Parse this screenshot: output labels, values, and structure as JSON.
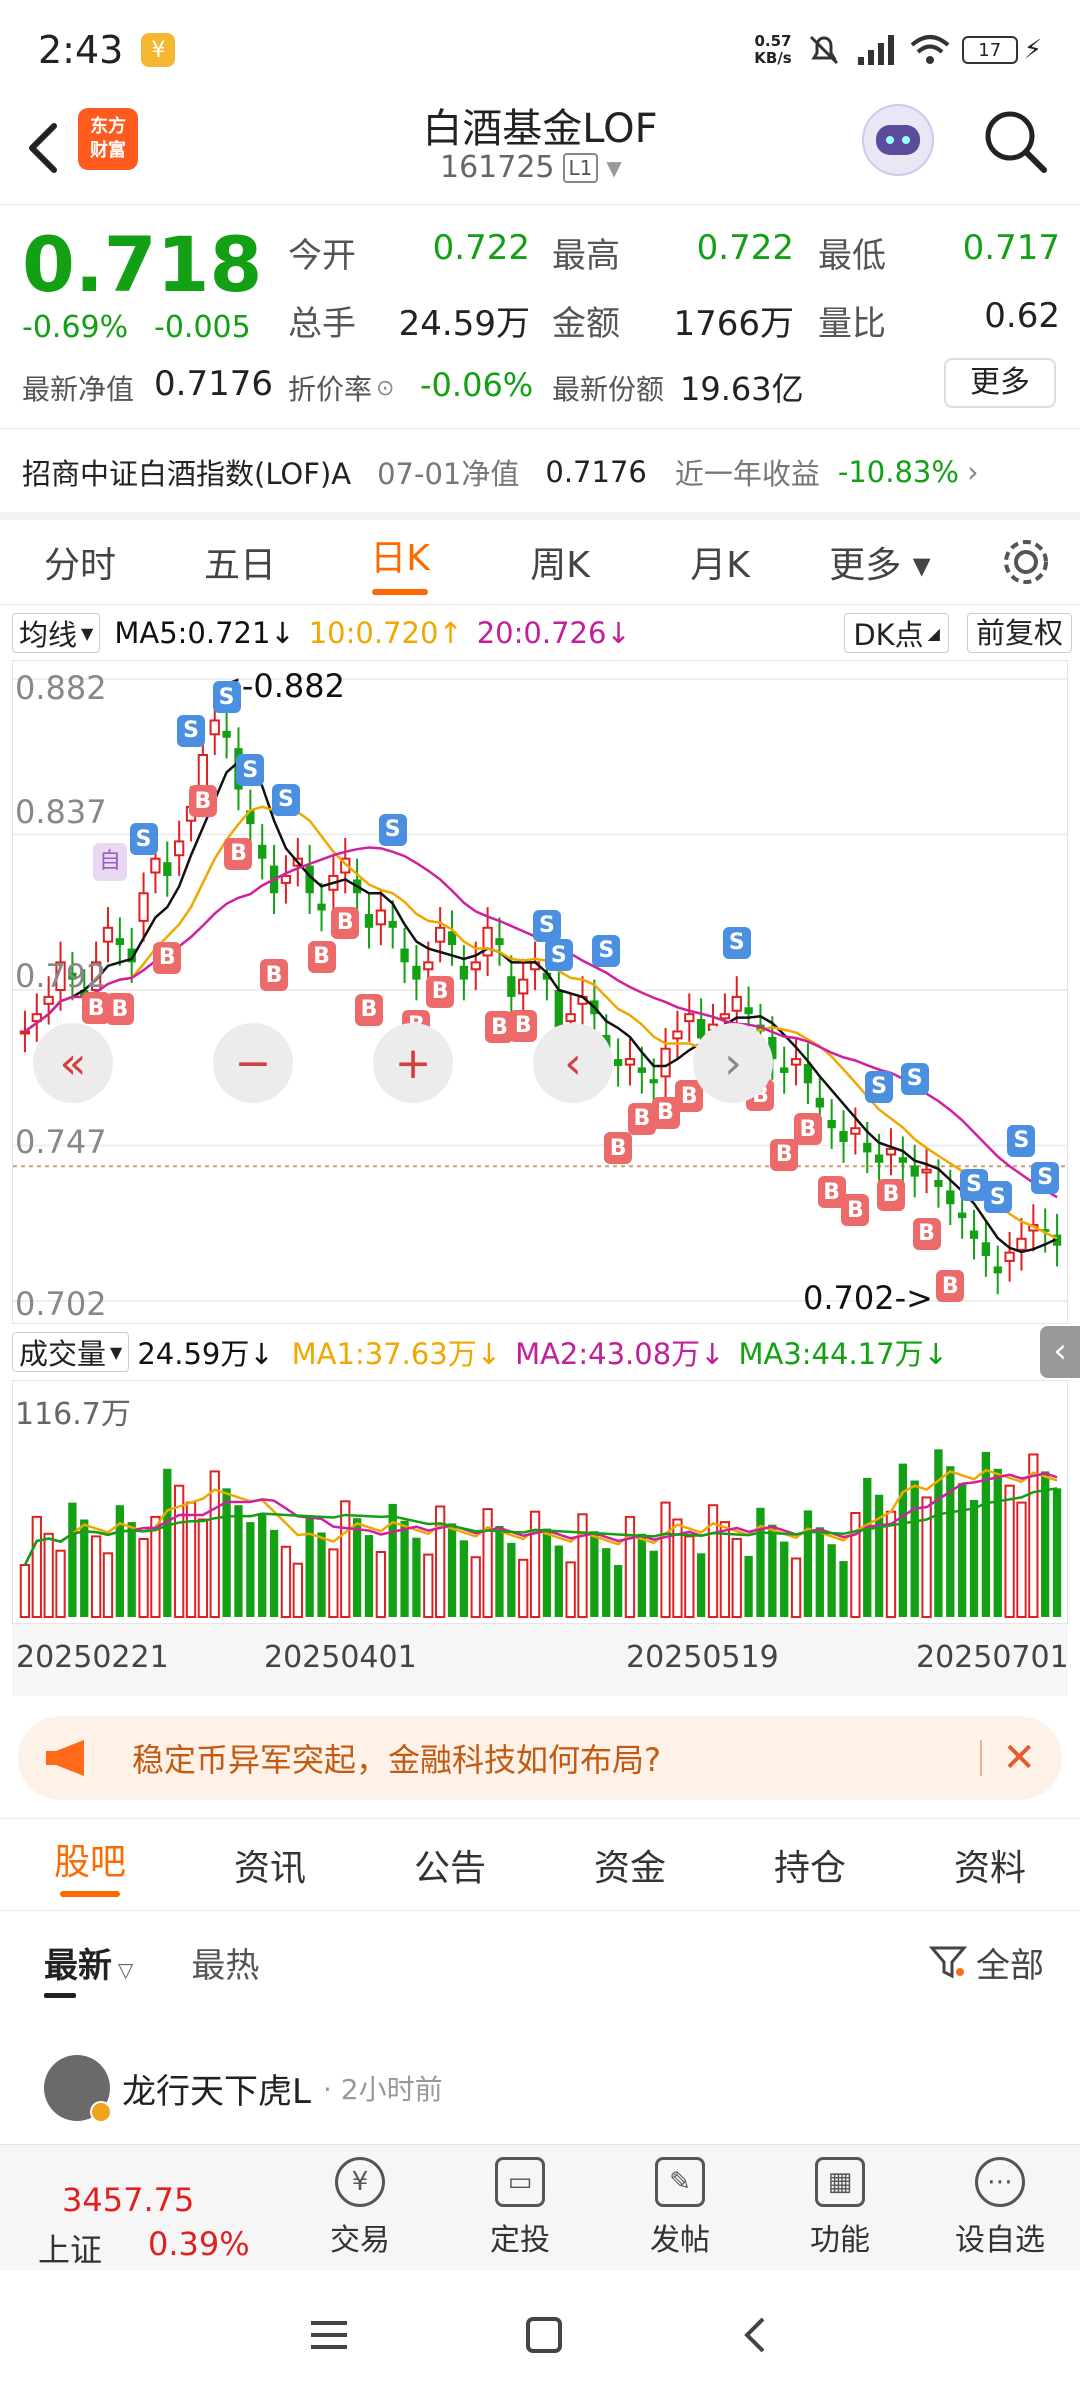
{
  "status_bar": {
    "time": "2:43",
    "speed_top": "0.57",
    "speed_bottom": "KB/s",
    "battery": "17"
  },
  "header": {
    "logo_line1": "东方",
    "logo_line2": "财富",
    "title": "白酒基金LOF",
    "code": "161725",
    "level": "L1"
  },
  "quote": {
    "price": "0.718",
    "change_pct": "-0.69%",
    "change": "-0.005",
    "open_label": "今开",
    "open": "0.722",
    "high_label": "最高",
    "high": "0.722",
    "low_label": "最低",
    "low": "0.717",
    "volume_label": "总手",
    "volume": "24.59万",
    "amount_label": "金额",
    "amount": "1766万",
    "ratio_label": "量比",
    "ratio": "0.62",
    "nav_label": "最新净值",
    "nav": "0.7176",
    "discount_label": "折价率",
    "discount": "-0.06%",
    "shares_label": "最新份额",
    "shares": "19.63亿",
    "more_label": "更多"
  },
  "fund_row": {
    "name": "招商中证白酒指数(LOF)A",
    "nav_label": "07-01净值",
    "nav": "0.7176",
    "return_label": "近一年收益",
    "return": "-10.83%"
  },
  "chart_tabs": [
    "分时",
    "五日",
    "日K",
    "周K",
    "月K",
    "更多"
  ],
  "active_tab": 2,
  "ma_bar": {
    "selector": "均线",
    "ma5": "MA5:0.721↓",
    "ma10": "10:0.720↑",
    "ma20": "20:0.726↓",
    "dk": "DK点",
    "fq": "前复权"
  },
  "price_axis": {
    "top": "0.882",
    "mid1": "0.837",
    "mid2": "0.792",
    "mid3": "0.747",
    "bottom": "0.702"
  },
  "annotations": {
    "max": "<-0.882",
    "min": "0.702->",
    "self": "自"
  },
  "markers": {
    "sell": "S",
    "buy": "B"
  },
  "vol_bar": {
    "selector": "成交量",
    "value": "24.59万↓",
    "ma1": "MA1:37.63万↓",
    "ma2": "MA2:43.08万↓",
    "ma3": "MA3:44.17万↓",
    "top": "116.7万"
  },
  "dates": [
    "20250221",
    "20250401",
    "20250519",
    "20250701"
  ],
  "colors": {
    "up": "#e02020",
    "down": "#14a014",
    "accent": "#ff6a00",
    "ma5": "#111111",
    "ma10": "#f0a800",
    "ma20": "#d020a0"
  },
  "chart_data": {
    "type": "candlestick",
    "ylim": [
      0.702,
      0.882
    ],
    "y_ticks": [
      "0.882",
      "0.837",
      "0.792",
      "0.747",
      "0.702"
    ],
    "x_ticks": [
      "20250221",
      "20250401",
      "20250519",
      "20250701"
    ],
    "close": [
      0.78,
      0.785,
      0.79,
      0.8,
      0.795,
      0.79,
      0.8,
      0.81,
      0.805,
      0.8,
      0.82,
      0.83,
      0.825,
      0.835,
      0.845,
      0.86,
      0.87,
      0.865,
      0.85,
      0.84,
      0.83,
      0.82,
      0.825,
      0.83,
      0.82,
      0.815,
      0.825,
      0.83,
      0.82,
      0.81,
      0.815,
      0.81,
      0.8,
      0.795,
      0.8,
      0.81,
      0.805,
      0.795,
      0.8,
      0.81,
      0.805,
      0.79,
      0.795,
      0.8,
      0.795,
      0.78,
      0.785,
      0.79,
      0.785,
      0.775,
      0.77,
      0.772,
      0.768,
      0.765,
      0.775,
      0.78,
      0.785,
      0.778,
      0.782,
      0.785,
      0.79,
      0.785,
      0.78,
      0.772,
      0.768,
      0.772,
      0.765,
      0.758,
      0.752,
      0.748,
      0.752,
      0.745,
      0.742,
      0.746,
      0.742,
      0.738,
      0.74,
      0.735,
      0.73,
      0.726,
      0.72,
      0.715,
      0.71,
      0.716,
      0.72,
      0.724,
      0.722,
      0.718
    ],
    "ma5_label": "MA5:0.721↓",
    "ma10_label": "10:0.720↑",
    "ma20_label": "20:0.726↓"
  },
  "promo": {
    "text": "稳定币异军突起，金融科技如何布局?"
  },
  "section_tabs": [
    "股吧",
    "资讯",
    "公告",
    "资金",
    "持仓",
    "资料"
  ],
  "active_section": 0,
  "sort": {
    "latest": "最新",
    "hot": "最热",
    "filter": "全部"
  },
  "post": {
    "user": "龙行天下虎L",
    "time": "· 2小时前"
  },
  "bottom_nav": {
    "index_value": "3457.75",
    "index_name": "上证",
    "index_pct": "0.39%",
    "items": [
      "交易",
      "定投",
      "发帖",
      "功能",
      "设自选"
    ]
  }
}
